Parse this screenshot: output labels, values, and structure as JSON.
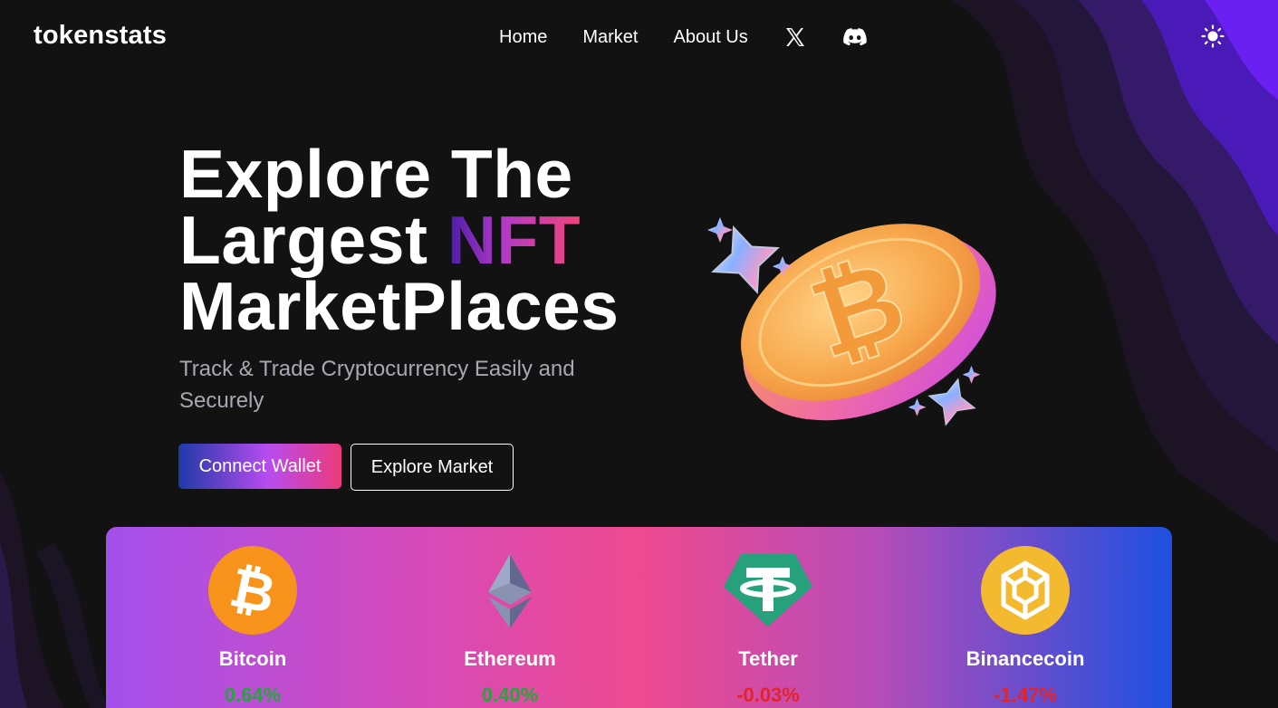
{
  "nav": {
    "brand": "tokenstats",
    "links": [
      "Home",
      "Market",
      "About Us"
    ],
    "icons": [
      "x-twitter-icon",
      "discord-icon"
    ],
    "theme_toggle_icon": "sun-icon"
  },
  "hero": {
    "title_line1": "Explore The",
    "title_line2_pre": "Largest ",
    "title_line2_highlight": "NFT",
    "title_line3": "MarketPlaces",
    "subtitle": "Track & Trade Cryptocurrency Easily and Securely",
    "connect_label": "Connect Wallet",
    "explore_label": "Explore Market",
    "image_icon": "bitcoin-coin-illustration"
  },
  "coins": [
    {
      "name": "Bitcoin",
      "change": "0.64%",
      "trend": "up",
      "icon": "bitcoin-icon",
      "color": "#f7931a"
    },
    {
      "name": "Ethereum",
      "change": "0.40%",
      "trend": "up",
      "icon": "ethereum-icon",
      "color": "#627eea"
    },
    {
      "name": "Tether",
      "change": "-0.03%",
      "trend": "down",
      "icon": "tether-icon",
      "color": "#26a17b"
    },
    {
      "name": "Binancecoin",
      "change": "-1.47%",
      "trend": "down",
      "icon": "binance-icon",
      "color": "#f3ba2f"
    }
  ],
  "colors": {
    "background": "#121212",
    "accent_purple": "#5a1fe8",
    "positive": "#22a83a",
    "negative": "#e0242c"
  }
}
